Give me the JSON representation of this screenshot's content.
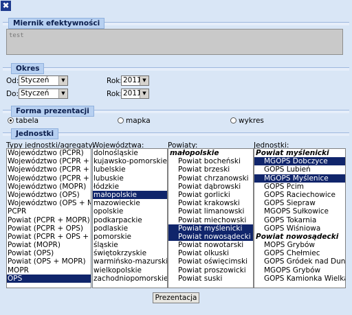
{
  "window": {
    "close_symbol": "✖"
  },
  "miernik": {
    "title": "Miernik efektywności",
    "value": "test"
  },
  "okres": {
    "title": "Okres",
    "od_label": "Od:",
    "do_label": "Do:",
    "od_month": "Styczeń",
    "do_month": "Styczeń",
    "rok_label": "Rok:",
    "od_year": "2011",
    "do_year": "2011"
  },
  "forma": {
    "title": "Forma prezentacji",
    "options": [
      {
        "label": "tabela",
        "checked": true
      },
      {
        "label": "mapka",
        "checked": false
      },
      {
        "label": "wykres",
        "checked": false
      }
    ]
  },
  "jednostki": {
    "title": "Jednostki",
    "typy": {
      "label": "Typy jednostki/agregaty:",
      "items": [
        {
          "text": "Województwo (PCPR)"
        },
        {
          "text": "Województwo (PCPR + MOPR)"
        },
        {
          "text": "Województwo (PCPR + OPS)"
        },
        {
          "text": "Województwo (PCPR + OPS + MOPR)"
        },
        {
          "text": "Województwo (MOPR)"
        },
        {
          "text": "Województwo (OPS)"
        },
        {
          "text": "Województwo (OPS + MOPR)"
        },
        {
          "text": "PCPR"
        },
        {
          "text": "Powiat (PCPR + MOPR)"
        },
        {
          "text": "Powiat (PCPR + OPS)"
        },
        {
          "text": "Powiat (PCPR + OPS + MOPR)"
        },
        {
          "text": "Powiat (MOPR)"
        },
        {
          "text": "Powiat (OPS)"
        },
        {
          "text": "Powiat (OPS + MOPR)"
        },
        {
          "text": "MOPR"
        },
        {
          "text": "OPS",
          "selected": true
        }
      ]
    },
    "wojewodztwa": {
      "label": "Województwa:",
      "items": [
        {
          "text": "dolnośląskie"
        },
        {
          "text": "kujawsko-pomorskie"
        },
        {
          "text": "lubelskie"
        },
        {
          "text": "lubuskie"
        },
        {
          "text": "łódzkie"
        },
        {
          "text": "małopolskie",
          "selected": true
        },
        {
          "text": "mazowieckie"
        },
        {
          "text": "opolskie"
        },
        {
          "text": "podkarpackie"
        },
        {
          "text": "podlaskie"
        },
        {
          "text": "pomorskie"
        },
        {
          "text": "śląskie"
        },
        {
          "text": "świętokrzyskie"
        },
        {
          "text": "warmińsko-mazurskie"
        },
        {
          "text": "wielkopolskie"
        },
        {
          "text": "zachodniopomorskie"
        }
      ]
    },
    "powiaty": {
      "label": "Powiaty:",
      "items": [
        {
          "text": "małopolskie",
          "group": true
        },
        {
          "text": "Powiat bocheński"
        },
        {
          "text": "Powiat brzeski"
        },
        {
          "text": "Powiat chrzanowski"
        },
        {
          "text": "Powiat dąbrowski"
        },
        {
          "text": "Powiat gorlicki"
        },
        {
          "text": "Powiat krakowski"
        },
        {
          "text": "Powiat limanowski"
        },
        {
          "text": "Powiat miechowski"
        },
        {
          "text": "Powiat myślenicki",
          "selected": true
        },
        {
          "text": "Powiat nowosądecki",
          "selected": true
        },
        {
          "text": "Powiat nowotarski"
        },
        {
          "text": "Powiat olkuski"
        },
        {
          "text": "Powiat oświęcimski"
        },
        {
          "text": "Powiat proszowicki"
        },
        {
          "text": "Powiat suski"
        }
      ]
    },
    "jednostki_list": {
      "label": "Jednostki:",
      "items": [
        {
          "text": "Powiat myślenicki",
          "group": true
        },
        {
          "text": "MGOPS Dobczyce",
          "selected": true
        },
        {
          "text": "GOPS Lubień"
        },
        {
          "text": "MGOPS Myślenice",
          "selected": true
        },
        {
          "text": "GOPS Pcim"
        },
        {
          "text": "GOPS Raciechowice"
        },
        {
          "text": "GOPS Siepraw"
        },
        {
          "text": "MGOPS Sułkowice"
        },
        {
          "text": "GOPS Tokarnia"
        },
        {
          "text": "GOPS Wiśniowa"
        },
        {
          "text": "Powiat nowosądecki",
          "group": true
        },
        {
          "text": "MOPS Grybów"
        },
        {
          "text": "GOPS Chełmiec"
        },
        {
          "text": "GOPS Gródek nad Dunajcem"
        },
        {
          "text": "MGOPS Grybów"
        },
        {
          "text": "GOPS Kamionka Wielka"
        }
      ]
    }
  },
  "submit_label": "Prezentacja",
  "colors": {
    "accent": "#10256b",
    "background": "#d9e6f6",
    "section_title": "#b7d0f1"
  }
}
